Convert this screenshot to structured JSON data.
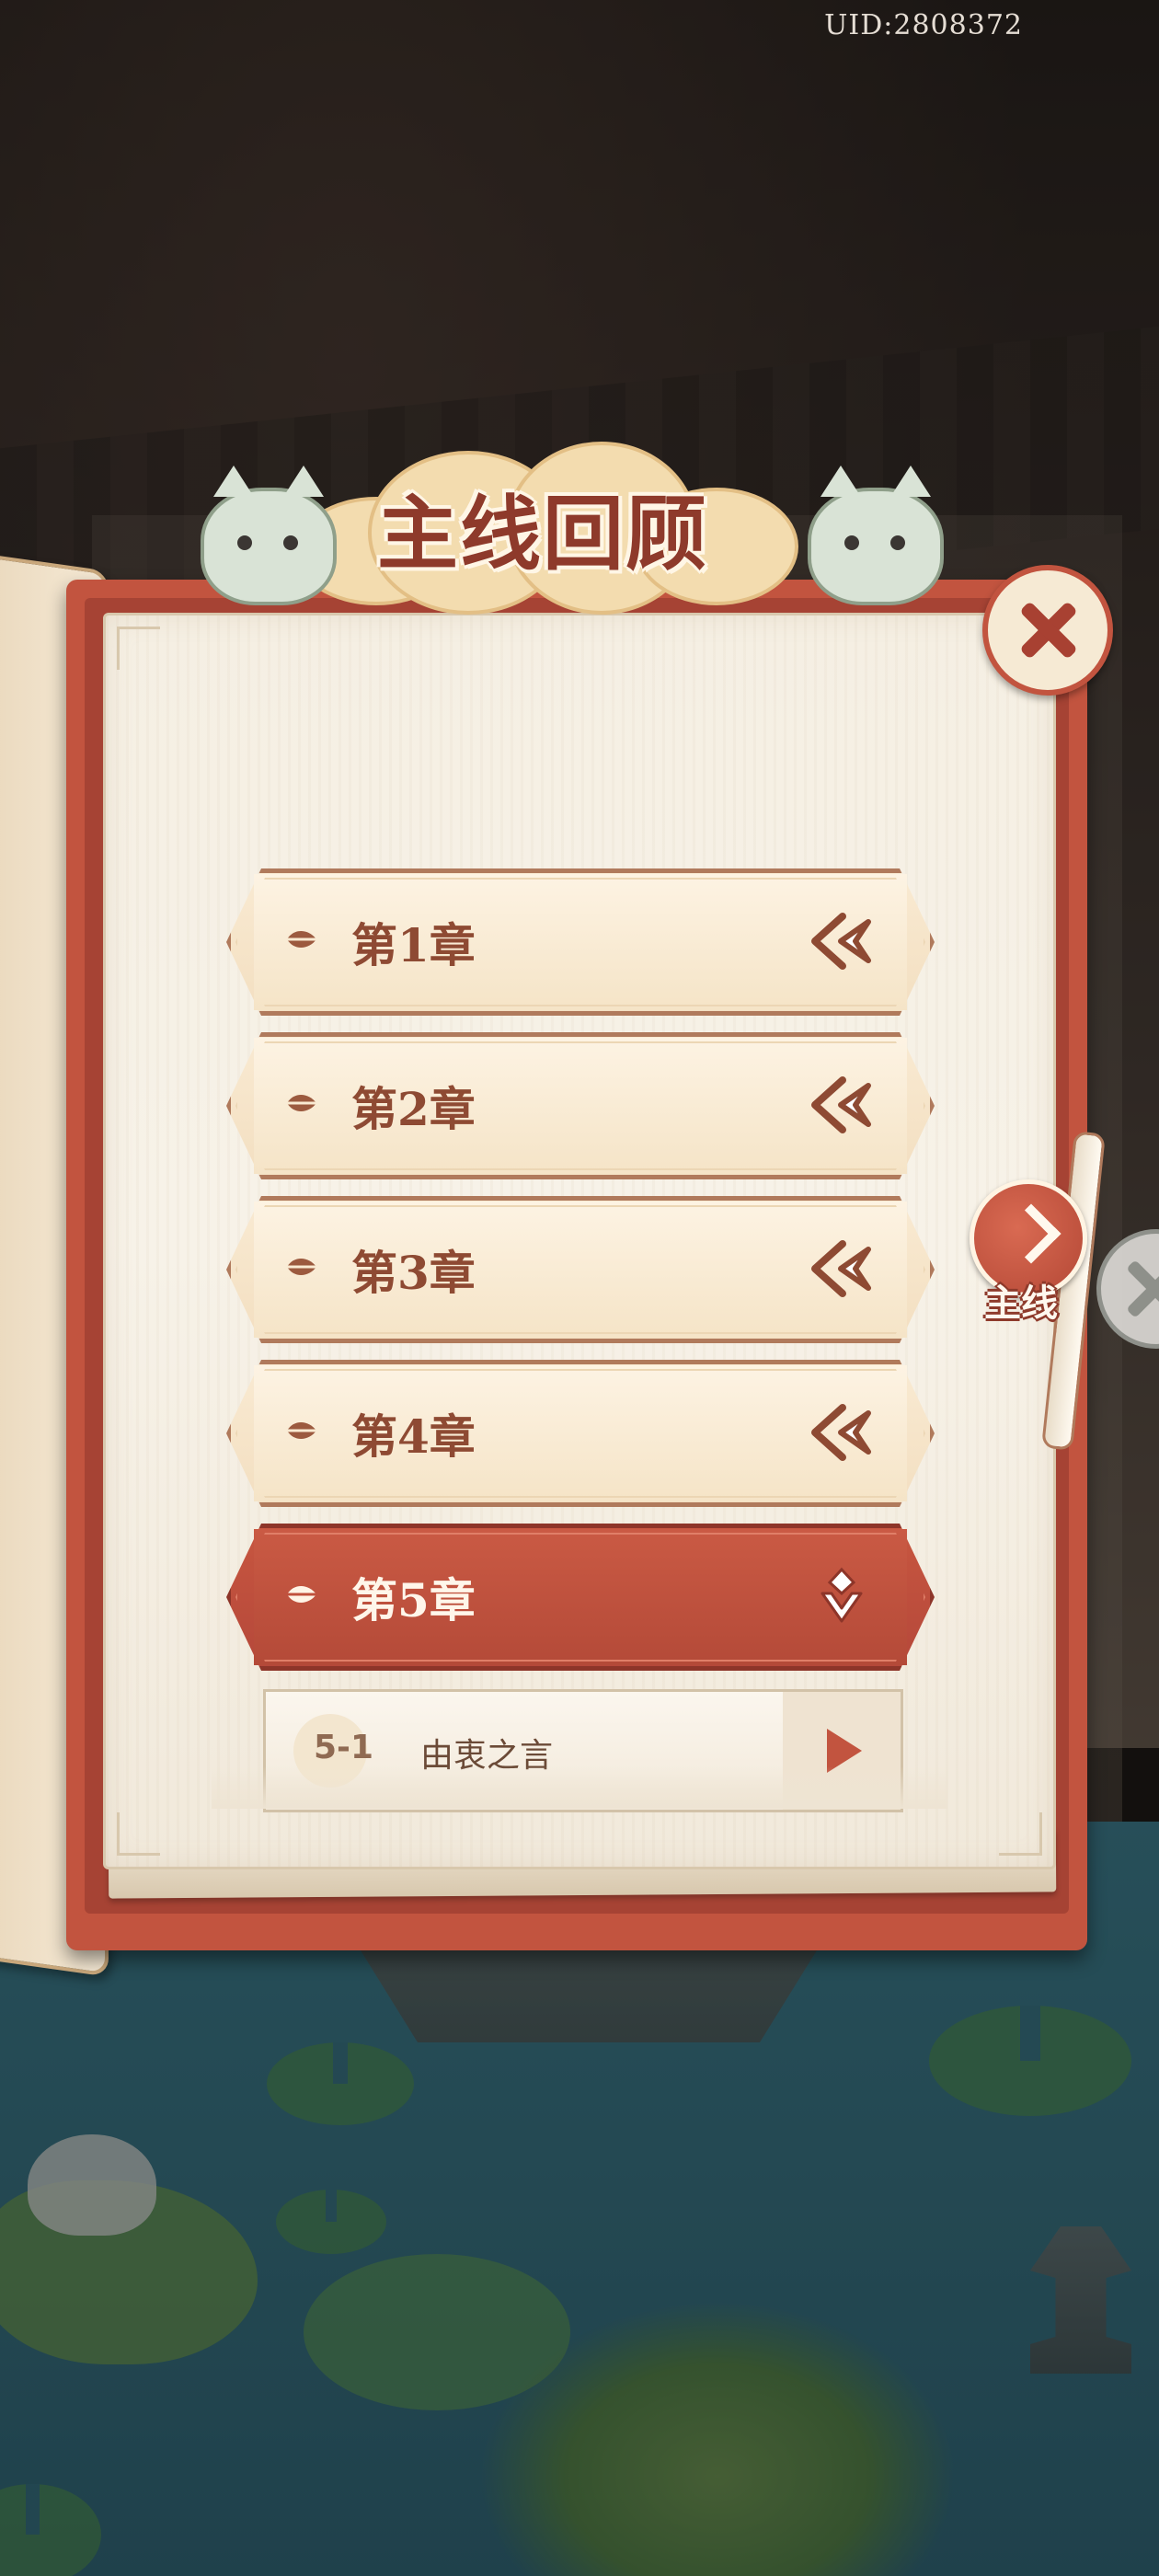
{
  "uid_label": "UID:2808372",
  "title": "主线回顾",
  "chapters": [
    {
      "label": "第1章",
      "state": "collapsed"
    },
    {
      "label": "第2章",
      "state": "collapsed"
    },
    {
      "label": "第3章",
      "state": "collapsed"
    },
    {
      "label": "第4章",
      "state": "collapsed"
    },
    {
      "label": "第5章",
      "state": "expanded"
    }
  ],
  "stages": [
    {
      "number": "5-1",
      "name": "由衷之言"
    }
  ],
  "side_tab": {
    "label": "主线",
    "icon": "chevron-right-icon"
  },
  "icons": {
    "close": "close-icon",
    "collapsed_arrow": "double-chevron-left-icon",
    "expanded_arrow": "chevron-down-icon",
    "leaf": "leaf-icon",
    "play": "play-icon"
  },
  "colors": {
    "accent": "#c2543f",
    "chapter_text": "#8e4a33",
    "paper": "#f5efe3"
  }
}
